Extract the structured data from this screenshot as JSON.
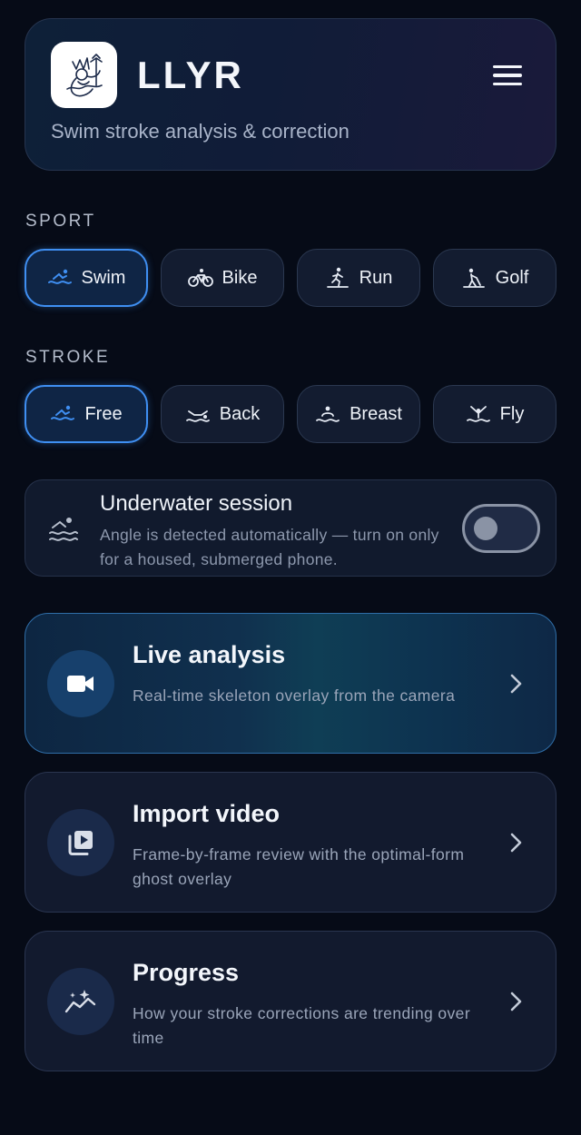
{
  "app": {
    "name": "LLYR",
    "tagline": "Swim stroke analysis & correction"
  },
  "sport": {
    "label": "SPORT",
    "options": [
      {
        "label": "Swim",
        "icon": "swimmer-icon",
        "selected": true
      },
      {
        "label": "Bike",
        "icon": "bike-icon",
        "selected": false
      },
      {
        "label": "Run",
        "icon": "runner-icon",
        "selected": false
      },
      {
        "label": "Golf",
        "icon": "golfer-icon",
        "selected": false
      }
    ]
  },
  "stroke": {
    "label": "STROKE",
    "options": [
      {
        "label": "Free",
        "icon": "freestyle-icon",
        "selected": true
      },
      {
        "label": "Back",
        "icon": "backstroke-icon",
        "selected": false
      },
      {
        "label": "Breast",
        "icon": "breaststroke-icon",
        "selected": false
      },
      {
        "label": "Fly",
        "icon": "butterfly-icon",
        "selected": false
      }
    ]
  },
  "underwater": {
    "title": "Underwater session",
    "description": "Angle is detected automatically — turn on only for a housed, submerged phone.",
    "enabled": false
  },
  "actions": [
    {
      "title": "Live analysis",
      "description": "Real-time skeleton overlay from the camera",
      "icon": "video-camera-icon"
    },
    {
      "title": "Import video",
      "description": "Frame-by-frame review with the optimal-form ghost overlay",
      "icon": "video-library-icon"
    },
    {
      "title": "Progress",
      "description": "How your stroke corrections are trending over time",
      "icon": "trend-sparkle-icon"
    }
  ],
  "colors": {
    "background": "#060b17",
    "accent": "#3f8ff2",
    "card": "#121a2e"
  }
}
